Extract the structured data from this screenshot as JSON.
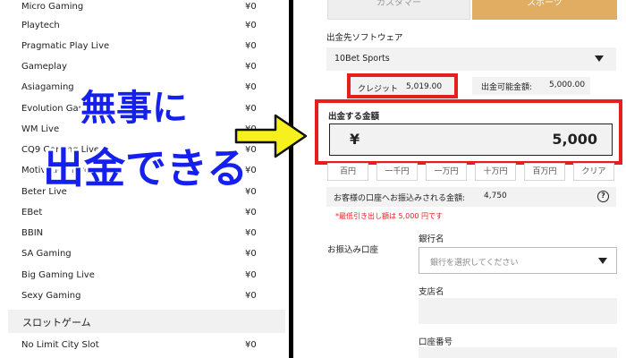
{
  "providers": [
    {
      "name": "Micro Gaming",
      "value": "¥0"
    },
    {
      "name": "Playtech",
      "value": "¥0"
    },
    {
      "name": "Pragmatic Play Live",
      "value": "¥0"
    },
    {
      "name": "Gameplay",
      "value": "¥0"
    },
    {
      "name": "Asiagaming",
      "value": "¥0"
    },
    {
      "name": "Evolution Gaming",
      "value": "¥0"
    },
    {
      "name": "WM Live",
      "value": "¥0"
    },
    {
      "name": "CQ9 Gaming Live",
      "value": "¥0"
    },
    {
      "name": "Motivation Live",
      "value": "¥0"
    },
    {
      "name": "Beter Live",
      "value": "¥0"
    },
    {
      "name": "EBet",
      "value": "¥0"
    },
    {
      "name": "BBIN",
      "value": "¥0"
    },
    {
      "name": "SA Gaming",
      "value": "¥0"
    },
    {
      "name": "Big Gaming Live",
      "value": "¥0"
    },
    {
      "name": "Sexy Gaming",
      "value": "¥0"
    }
  ],
  "slot_section": {
    "title": "スロットゲーム"
  },
  "slot_providers": [
    {
      "name": "No Limit City Slot",
      "value": "¥0"
    }
  ],
  "tabs": {
    "left_label": "カスタマー",
    "right_label": "スポーツ"
  },
  "withdraw": {
    "software_label": "出金先ソフトウェア",
    "software_value": "10Bet Sports",
    "credit_label": "クレジット",
    "credit_value": "5,019.00",
    "available_label": "出金可能金額:",
    "available_value": "5,000.00",
    "amount_label": "出金する金額",
    "currency_symbol": "¥",
    "amount_value": "5,000",
    "quick_buttons": [
      "百円",
      "一千円",
      "一万円",
      "十万円",
      "百万円",
      "クリア"
    ],
    "received_label": "お客様の口座へお振込みされる金額:",
    "received_value": "4,750",
    "min_note": "*最低引き出し額は 5,000 円です"
  },
  "bank": {
    "section_label": "お振込み口座",
    "bank_name_label": "銀行名",
    "bank_select_placeholder": "銀行を選択してください",
    "branch_label": "支店名",
    "account_number_label": "口座番号"
  },
  "overlay": {
    "line1": "無事に",
    "line2": "出金できる"
  },
  "colors": {
    "accent_tab": "#e0ad62",
    "highlight_red": "#e61e1e",
    "overlay_blue": "#1520ee",
    "arrow_yellow": "#f5f01e"
  }
}
